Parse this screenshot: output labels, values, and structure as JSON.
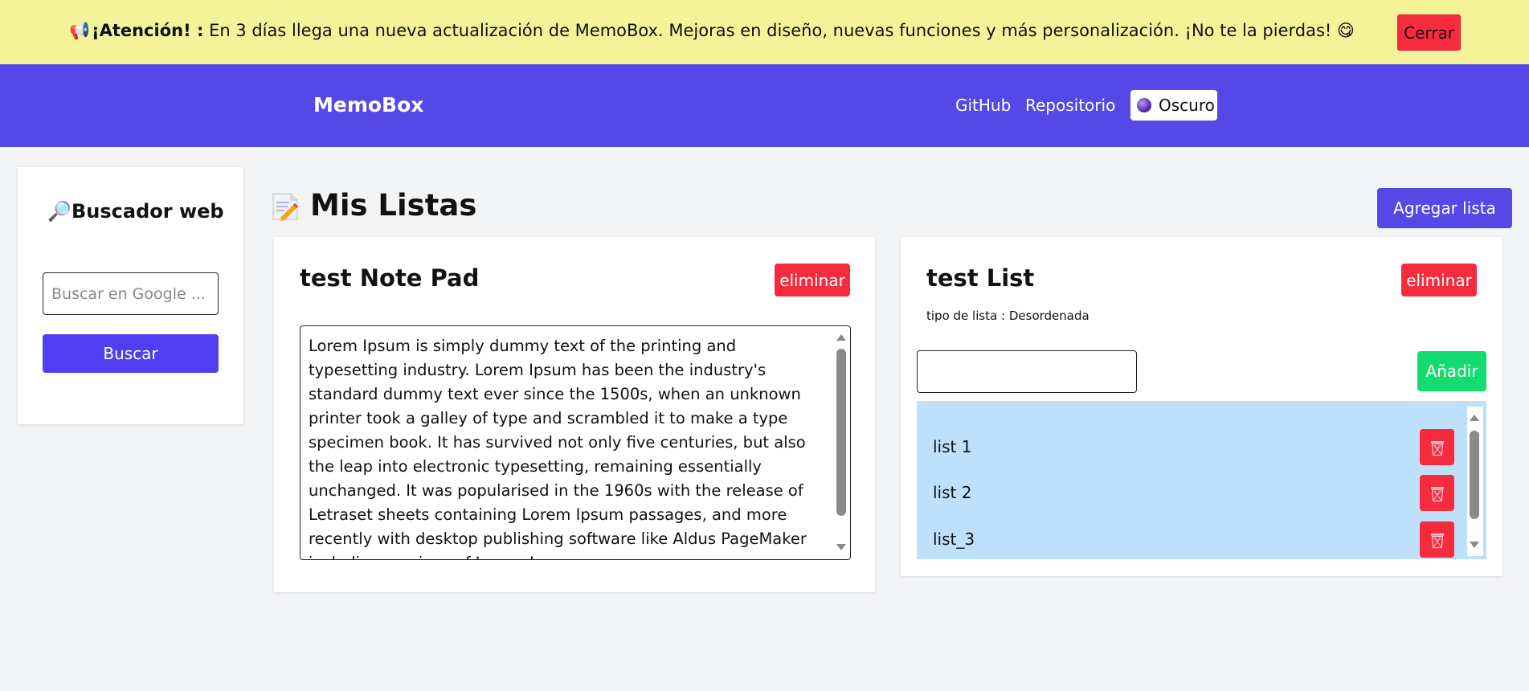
{
  "banner": {
    "icon": "megaphone-icon",
    "emoji": "📢",
    "bold": "¡Atención! :",
    "message": "En 3 días llega una nueva actualización de MemoBox. Mejoras en diseño, nuevas funciones y más personalización. ¡No te la pierdas! 😋",
    "close_label": "Cerrar"
  },
  "navbar": {
    "brand": "MemoBox",
    "links": [
      "GitHub",
      "Repositorio"
    ],
    "theme_label": "Oscuro"
  },
  "search": {
    "icon": "magnifier-icon",
    "emoji": "🔎",
    "title": "Buscador web",
    "placeholder": "Buscar en Google ...",
    "button_label": "Buscar"
  },
  "main": {
    "title": "Mis Listas",
    "add_list_label": "Agregar lista"
  },
  "notes": [
    {
      "title": "test Note Pad",
      "delete_label": "eliminar",
      "content": "Lorem Ipsum is simply dummy text of the printing and typesetting industry. Lorem Ipsum has been the industry's standard dummy text ever since the 1500s, when an unknown printer took a galley of type and scrambled it to make a type specimen book. It has survived not only five centuries, but also the leap into electronic typesetting, remaining essentially unchanged. It was popularised in the 1960s with the release of Letraset sheets containing Lorem Ipsum passages, and more recently with desktop publishing software like Aldus PageMaker including versions of Lorem Ipsum."
    }
  ],
  "lists": [
    {
      "title": "test List",
      "delete_label": "eliminar",
      "type_text": "tipo de lista : Desordenada",
      "input_value": "",
      "add_label": "Añadir",
      "items": [
        "list 1",
        "list 2",
        "list_3"
      ]
    }
  ],
  "colors": {
    "banner_bg": "#f5f39a",
    "navbar_bg": "#5449e6",
    "primary": "#4f3ff0",
    "danger": "#f62b3d",
    "success": "#13dc6f",
    "list_bg": "#bfe0fb"
  }
}
